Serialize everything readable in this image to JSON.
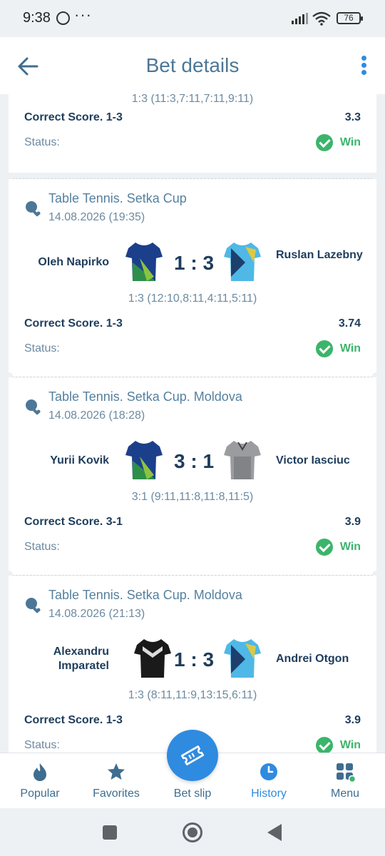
{
  "status_bar": {
    "time": "9:38",
    "more": "···",
    "battery": "76"
  },
  "header": {
    "title": "Bet details"
  },
  "partial_bet": {
    "sets": "1:3 (11:3,7:11,7:11,9:11)",
    "market": "Correct Score. 1-3",
    "odds": "3.3",
    "status_label": "Status:",
    "status_value": "Win"
  },
  "bets": [
    {
      "tournament": "Table Tennis. Setka Cup",
      "date": "14.08.2026 (19:35)",
      "team1": "Oleh Napirko",
      "team2": "Ruslan Lazebny",
      "score": "1 : 3",
      "sets": "1:3 (12:10,8:11,4:11,5:11)",
      "market": "Correct Score. 1-3",
      "odds": "3.74",
      "status_label": "Status:",
      "status_value": "Win"
    },
    {
      "tournament": "Table Tennis. Setka Cup. Moldova",
      "date": "14.08.2026 (18:28)",
      "team1": "Yurii Kovik",
      "team2": "Victor Iasciuc",
      "score": "3 : 1",
      "sets": "3:1 (9:11,11:8,11:8,11:5)",
      "market": "Correct Score. 3-1",
      "odds": "3.9",
      "status_label": "Status:",
      "status_value": "Win"
    },
    {
      "tournament": "Table Tennis. Setka Cup. Moldova",
      "date": "14.08.2026 (21:13)",
      "team1": "Alexandru Imparatel",
      "team2": "Andrei Otgon",
      "score": "1 : 3",
      "sets": "1:3 (8:11,11:9,13:15,6:11)",
      "market": "Correct Score. 1-3",
      "odds": "3.9",
      "status_label": "Status:",
      "status_value": "Win"
    }
  ],
  "nav": {
    "popular": "Popular",
    "favorites": "Favorites",
    "betslip": "Bet slip",
    "history": "History",
    "menu": "Menu"
  },
  "colors": {
    "accent": "#2f8be0",
    "win": "#3bb56b",
    "title": "#4d7796",
    "dark_text": "#1e3d5c"
  }
}
